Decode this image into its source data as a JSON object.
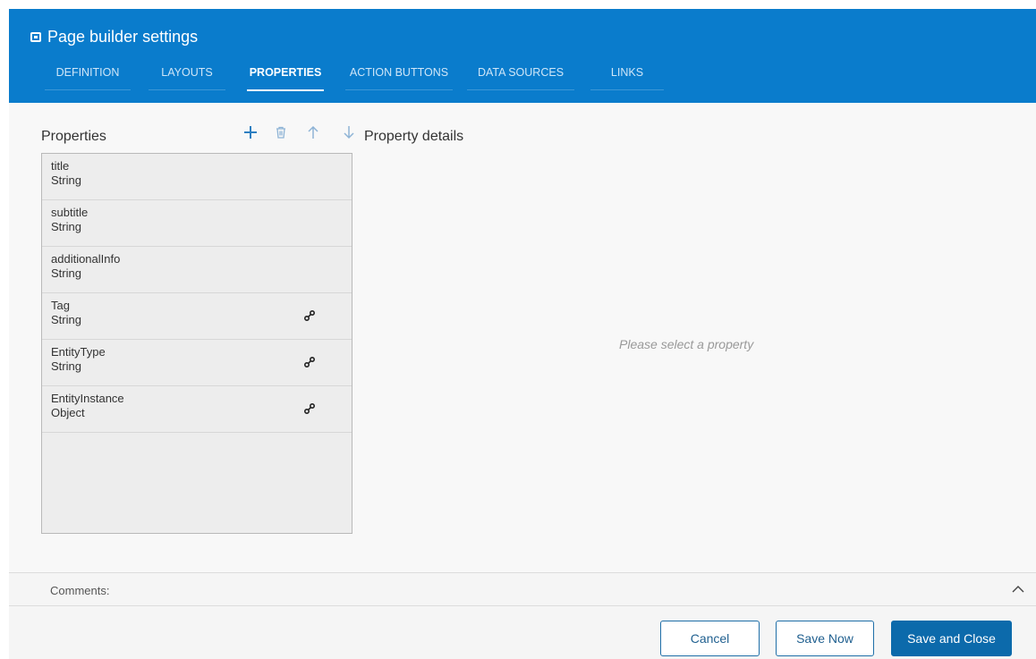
{
  "header": {
    "title": "Page builder settings",
    "tabs": [
      {
        "label": "DEFINITION",
        "active": false
      },
      {
        "label": "LAYOUTS",
        "active": false
      },
      {
        "label": "PROPERTIES",
        "active": true
      },
      {
        "label": "ACTION BUTTONS",
        "active": false
      },
      {
        "label": "DATA SOURCES",
        "active": false
      },
      {
        "label": "LINKS",
        "active": false
      }
    ]
  },
  "properties_panel": {
    "title": "Properties",
    "items": [
      {
        "name": "title",
        "type": "String",
        "linked": false
      },
      {
        "name": "subtitle",
        "type": "String",
        "linked": false
      },
      {
        "name": "additionalInfo",
        "type": "String",
        "linked": false
      },
      {
        "name": "Tag",
        "type": "String",
        "linked": true
      },
      {
        "name": "EntityType",
        "type": "String",
        "linked": true
      },
      {
        "name": "EntityInstance",
        "type": "Object",
        "linked": true
      }
    ]
  },
  "details_panel": {
    "title": "Property details",
    "placeholder": "Please select a property"
  },
  "comments": {
    "label": "Comments:"
  },
  "footer": {
    "cancel_label": "Cancel",
    "save_now_label": "Save Now",
    "save_close_label": "Save and Close"
  },
  "colors": {
    "header_bg": "#0a7ccc",
    "accent": "#2d7fc1",
    "primary_button": "#0c6aab"
  },
  "icons": {
    "add": "plus-icon",
    "delete": "trash-icon",
    "move_up": "arrow-up-icon",
    "move_down": "arrow-down-icon",
    "link": "link-icon",
    "collapse": "chevron-up-icon"
  }
}
